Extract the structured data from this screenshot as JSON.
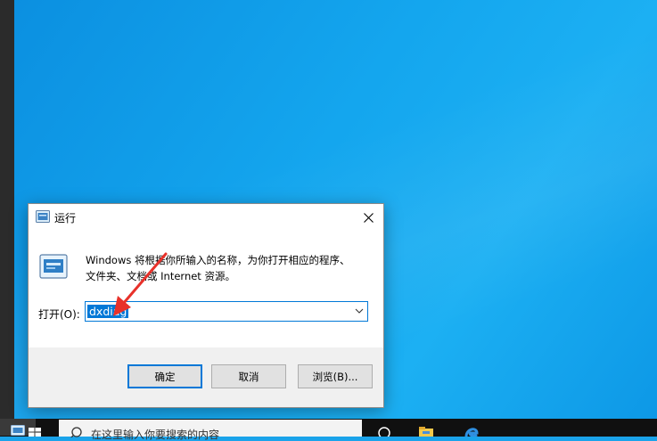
{
  "dialog": {
    "title": "运行",
    "description_line1": "Windows 将根据你所输入的名称，为你打开相应的程序、",
    "description_line2": "文件夹、文档或 Internet 资源。",
    "open_label": "打开(O):",
    "input_value": "dxdiag",
    "buttons": {
      "ok": "确定",
      "cancel": "取消",
      "browse": "浏览(B)..."
    }
  },
  "taskbar": {
    "search_placeholder": "在这里输入你要搜索的内容"
  },
  "colors": {
    "desktop": "#1aa3ea",
    "accent": "#0078d7",
    "annotation_arrow": "#e8312a",
    "taskbar": "#101010"
  },
  "icons": [
    "run-app-icon",
    "close-icon",
    "chevron-down-icon",
    "windows-start-icon",
    "search-icon",
    "task-view-icon",
    "file-explorer-icon",
    "edge-icon"
  ]
}
